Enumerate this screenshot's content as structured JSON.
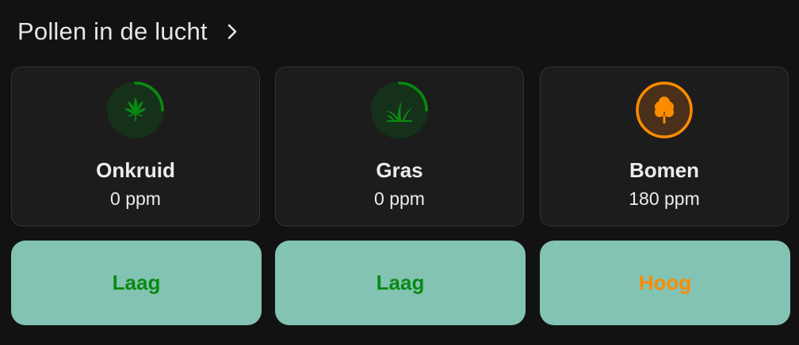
{
  "header": {
    "title": "Pollen in de lucht"
  },
  "colors": {
    "low": "#0a8a12",
    "high": "#fb8c00",
    "button_bg": "#83c3b3"
  },
  "cards": [
    {
      "name": "Onkruid",
      "value": "0 ppm",
      "icon": "weed-icon",
      "level": 0.25,
      "color": "#0a8a12"
    },
    {
      "name": "Gras",
      "value": "0 ppm",
      "icon": "grass-icon",
      "level": 0.25,
      "color": "#0a8a12"
    },
    {
      "name": "Bomen",
      "value": "180 ppm",
      "icon": "tree-icon",
      "level": 1.0,
      "color": "#fb8c00"
    }
  ],
  "levels": [
    {
      "label": "Laag",
      "color": "#0a8a12"
    },
    {
      "label": "Laag",
      "color": "#0a8a12"
    },
    {
      "label": "Hoog",
      "color": "#fb8c00"
    }
  ]
}
